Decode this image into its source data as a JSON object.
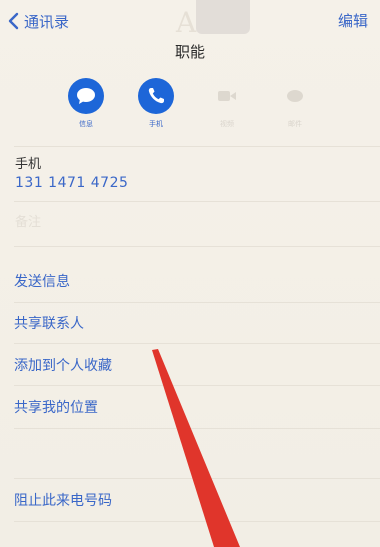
{
  "nav": {
    "back_label": "通讯录",
    "edit_label": "编辑"
  },
  "contact": {
    "name": "职能"
  },
  "actions": [
    {
      "label": "信息",
      "icon": "message-icon",
      "state": "active"
    },
    {
      "label": "手机",
      "icon": "phone-icon",
      "state": "active"
    },
    {
      "label": "视频",
      "icon": "video-icon",
      "state": "disabled"
    },
    {
      "label": "邮件",
      "icon": "mail-icon",
      "state": "disabled"
    }
  ],
  "phone": {
    "label": "手机",
    "number": "131 1471 4725"
  },
  "notes_label": "备注",
  "menu": {
    "send_message": "发送信息",
    "share_contact": "共享联系人",
    "add_favorite": "添加到个人收藏",
    "share_location": "共享我的位置",
    "block_caller": "阻止此来电号码"
  },
  "colors": {
    "accent": "#1d66d8",
    "link": "#3a67c8",
    "arrow": "#e0352b",
    "background": "#f3efe6"
  }
}
